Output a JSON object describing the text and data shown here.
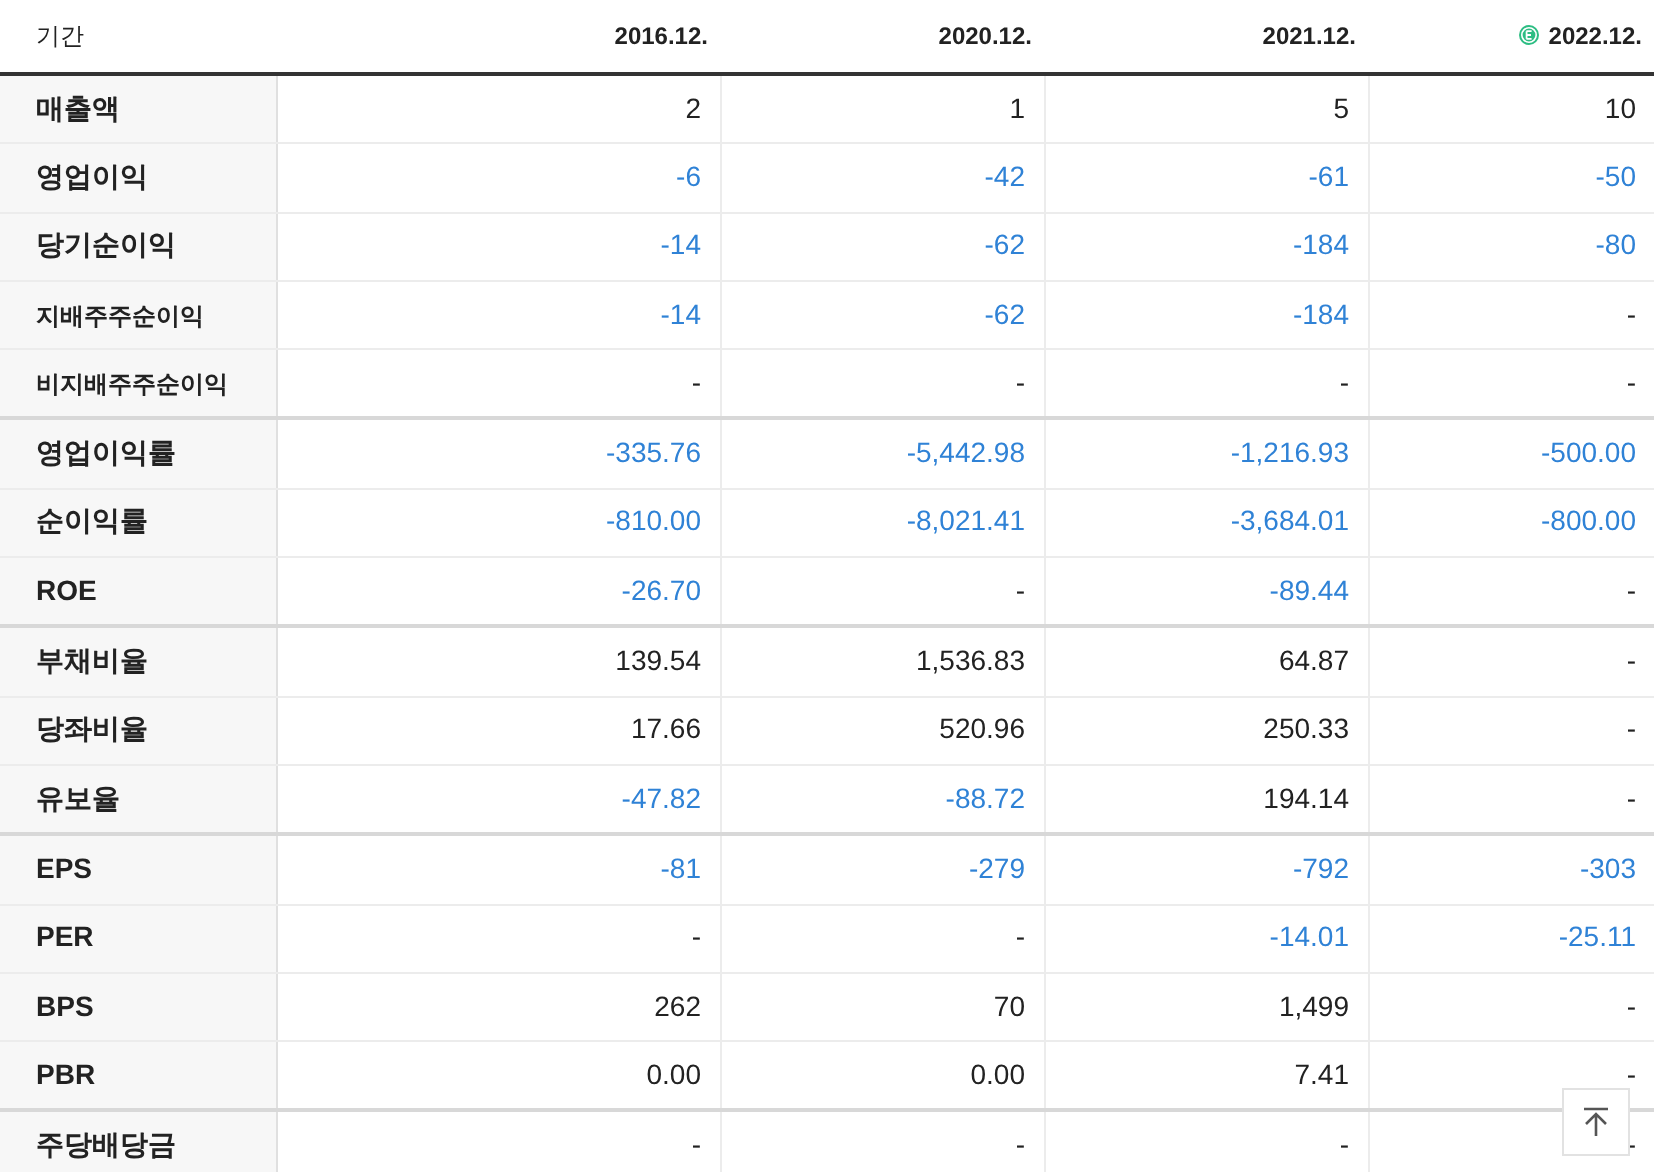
{
  "table": {
    "columns": [
      {
        "label": "기간",
        "estimate": false
      },
      {
        "label": "2016.12.",
        "estimate": false
      },
      {
        "label": "2020.12.",
        "estimate": false
      },
      {
        "label": "2021.12.",
        "estimate": false
      },
      {
        "label": "2022.12.",
        "estimate": true
      }
    ],
    "groups": [
      {
        "rows": [
          {
            "label": "매출액",
            "kind": "main",
            "cells": [
              {
                "value": "2",
                "negative": false
              },
              {
                "value": "1",
                "negative": false
              },
              {
                "value": "5",
                "negative": false
              },
              {
                "value": "10",
                "negative": false
              }
            ]
          },
          {
            "label": "영업이익",
            "kind": "main",
            "cells": [
              {
                "value": "-6",
                "negative": true
              },
              {
                "value": "-42",
                "negative": true
              },
              {
                "value": "-61",
                "negative": true
              },
              {
                "value": "-50",
                "negative": true
              }
            ]
          },
          {
            "label": "당기순이익",
            "kind": "main",
            "cells": [
              {
                "value": "-14",
                "negative": true
              },
              {
                "value": "-62",
                "negative": true
              },
              {
                "value": "-184",
                "negative": true
              },
              {
                "value": "-80",
                "negative": true
              }
            ]
          },
          {
            "label": "지배주주순이익",
            "kind": "sub",
            "cells": [
              {
                "value": "-14",
                "negative": true
              },
              {
                "value": "-62",
                "negative": true
              },
              {
                "value": "-184",
                "negative": true
              },
              {
                "value": "-",
                "negative": false
              }
            ]
          },
          {
            "label": "비지배주주순이익",
            "kind": "sub",
            "cells": [
              {
                "value": "-",
                "negative": false
              },
              {
                "value": "-",
                "negative": false
              },
              {
                "value": "-",
                "negative": false
              },
              {
                "value": "-",
                "negative": false
              }
            ]
          }
        ]
      },
      {
        "rows": [
          {
            "label": "영업이익률",
            "kind": "main",
            "cells": [
              {
                "value": "-335.76",
                "negative": true
              },
              {
                "value": "-5,442.98",
                "negative": true
              },
              {
                "value": "-1,216.93",
                "negative": true
              },
              {
                "value": "-500.00",
                "negative": true
              }
            ]
          },
          {
            "label": "순이익률",
            "kind": "main",
            "cells": [
              {
                "value": "-810.00",
                "negative": true
              },
              {
                "value": "-8,021.41",
                "negative": true
              },
              {
                "value": "-3,684.01",
                "negative": true
              },
              {
                "value": "-800.00",
                "negative": true
              }
            ]
          },
          {
            "label": "ROE",
            "kind": "main",
            "cells": [
              {
                "value": "-26.70",
                "negative": true
              },
              {
                "value": "-",
                "negative": false
              },
              {
                "value": "-89.44",
                "negative": true
              },
              {
                "value": "-",
                "negative": false
              }
            ]
          }
        ]
      },
      {
        "rows": [
          {
            "label": "부채비율",
            "kind": "main",
            "cells": [
              {
                "value": "139.54",
                "negative": false
              },
              {
                "value": "1,536.83",
                "negative": false
              },
              {
                "value": "64.87",
                "negative": false
              },
              {
                "value": "-",
                "negative": false
              }
            ]
          },
          {
            "label": "당좌비율",
            "kind": "main",
            "cells": [
              {
                "value": "17.66",
                "negative": false
              },
              {
                "value": "520.96",
                "negative": false
              },
              {
                "value": "250.33",
                "negative": false
              },
              {
                "value": "-",
                "negative": false
              }
            ]
          },
          {
            "label": "유보율",
            "kind": "main",
            "cells": [
              {
                "value": "-47.82",
                "negative": true
              },
              {
                "value": "-88.72",
                "negative": true
              },
              {
                "value": "194.14",
                "negative": false
              },
              {
                "value": "-",
                "negative": false
              }
            ]
          }
        ]
      },
      {
        "rows": [
          {
            "label": "EPS",
            "kind": "main",
            "cells": [
              {
                "value": "-81",
                "negative": true
              },
              {
                "value": "-279",
                "negative": true
              },
              {
                "value": "-792",
                "negative": true
              },
              {
                "value": "-303",
                "negative": true
              }
            ]
          },
          {
            "label": "PER",
            "kind": "main",
            "cells": [
              {
                "value": "-",
                "negative": false
              },
              {
                "value": "-",
                "negative": false
              },
              {
                "value": "-14.01",
                "negative": true
              },
              {
                "value": "-25.11",
                "negative": true
              }
            ]
          },
          {
            "label": "BPS",
            "kind": "main",
            "cells": [
              {
                "value": "262",
                "negative": false
              },
              {
                "value": "70",
                "negative": false
              },
              {
                "value": "1,499",
                "negative": false
              },
              {
                "value": "-",
                "negative": false
              }
            ]
          },
          {
            "label": "PBR",
            "kind": "main",
            "cells": [
              {
                "value": "0.00",
                "negative": false
              },
              {
                "value": "0.00",
                "negative": false
              },
              {
                "value": "7.41",
                "negative": false
              },
              {
                "value": "-",
                "negative": false
              }
            ]
          }
        ]
      },
      {
        "rows": [
          {
            "label": "주당배당금",
            "kind": "main",
            "cells": [
              {
                "value": "-",
                "negative": false
              },
              {
                "value": "-",
                "negative": false
              },
              {
                "value": "-",
                "negative": false
              },
              {
                "value": "-",
                "negative": false
              }
            ]
          }
        ]
      }
    ]
  }
}
